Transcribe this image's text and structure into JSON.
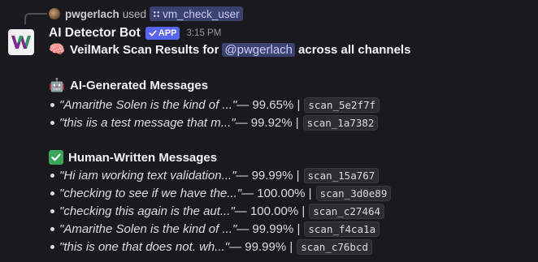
{
  "reply": {
    "user": "pwgerlach",
    "used": "used",
    "command": "vm_check_user"
  },
  "author": {
    "name": "AI Detector Bot",
    "tag": "APP",
    "time": "3:15 PM"
  },
  "title": {
    "prefix": "VeilMark Scan Results for",
    "mention": "@pwgerlach",
    "suffix": "across all channels"
  },
  "ai_section": {
    "heading": "AI-Generated Messages",
    "items": [
      {
        "quote": "\"Amarithe Solen is the kind of ...\"",
        "pct": " — 99.65% |",
        "scan": "scan_5e2f7f"
      },
      {
        "quote": "\"this iis a test message that m...\"",
        "pct": " — 99.92% |",
        "scan": "scan_1a7382"
      }
    ]
  },
  "human_section": {
    "heading": "Human-Written Messages",
    "items": [
      {
        "quote": "\"Hi iam working text validation...\"",
        "pct": " — 99.99% |",
        "scan": "scan_15a767"
      },
      {
        "quote": "\"checking to see if we have the...\"",
        "pct": " — 100.00% |",
        "scan": "scan_3d0e89"
      },
      {
        "quote": "\"checking this again is the aut...\"",
        "pct": " — 100.00% |",
        "scan": "scan_c27464"
      },
      {
        "quote": "\"Amarithe Solen is the kind of ...\"",
        "pct": " — 99.99% |",
        "scan": "scan_f4ca1a"
      },
      {
        "quote": "\"this is one that does not.  wh...\"",
        "pct": " — 99.99% |",
        "scan": "scan_c76bcd"
      }
    ]
  },
  "colors": {
    "background": "#1a1a1e",
    "mention_bg": "#3c4270",
    "app_tag": "#5865f2"
  }
}
